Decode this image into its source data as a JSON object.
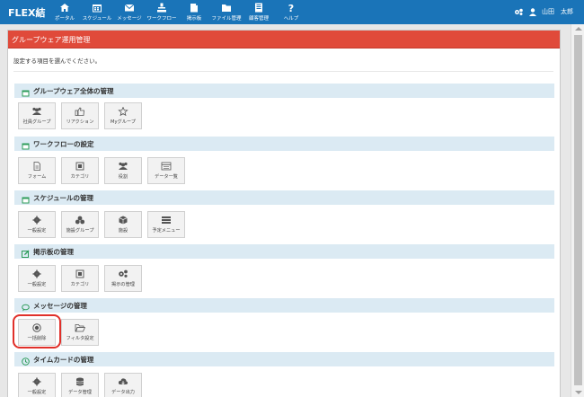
{
  "brand": {
    "logo": "FLEX結"
  },
  "nav": [
    {
      "label": "ポータル",
      "icon": "home-icon"
    },
    {
      "label": "スケジュール",
      "icon": "calendar-icon"
    },
    {
      "label": "メッセージ",
      "icon": "envelope-icon"
    },
    {
      "label": "ワークフロー",
      "icon": "workflow-icon"
    },
    {
      "label": "掲示板",
      "icon": "board-icon"
    },
    {
      "label": "ファイル管理",
      "icon": "folder-icon"
    },
    {
      "label": "顧客管理",
      "icon": "customer-icon"
    },
    {
      "label": "ヘルプ",
      "icon": "help-icon"
    }
  ],
  "user": {
    "name": "山田　太郎"
  },
  "panel": {
    "title": "グループウェア運用管理",
    "intro": "設定する項目を選んでください。"
  },
  "sections": [
    {
      "title": "グループウェア全体の管理",
      "icon": "calendar-icon",
      "tiles": [
        {
          "label": "社員グループ",
          "icon": "users-icon"
        },
        {
          "label": "リアクション",
          "icon": "thumbs-up-icon"
        },
        {
          "label": "Myグループ",
          "icon": "star-icon"
        }
      ]
    },
    {
      "title": "ワークフローの設定",
      "icon": "calendar-icon",
      "tiles": [
        {
          "label": "フォーム",
          "icon": "document-icon"
        },
        {
          "label": "カテゴリ",
          "icon": "category-icon"
        },
        {
          "label": "役割",
          "icon": "users-icon"
        },
        {
          "label": "データ一覧",
          "icon": "list-icon"
        }
      ]
    },
    {
      "title": "スケジュールの管理",
      "icon": "calendar-icon",
      "tiles": [
        {
          "label": "一般設定",
          "icon": "gear-icon"
        },
        {
          "label": "施設グループ",
          "icon": "facility-group-icon"
        },
        {
          "label": "施設",
          "icon": "cube-icon"
        },
        {
          "label": "予定メニュー",
          "icon": "menu-icon"
        }
      ]
    },
    {
      "title": "掲示板の管理",
      "icon": "edit-icon",
      "tiles": [
        {
          "label": "一般設定",
          "icon": "gear-icon"
        },
        {
          "label": "カテゴリ",
          "icon": "category-icon"
        },
        {
          "label": "掲示の管理",
          "icon": "gears-icon"
        }
      ]
    },
    {
      "title": "メッセージの管理",
      "icon": "chat-icon",
      "tiles": [
        {
          "label": "一括削除",
          "icon": "record-icon"
        },
        {
          "label": "フィルタ設定",
          "icon": "folder-open-icon"
        }
      ]
    },
    {
      "title": "タイムカードの管理",
      "icon": "clock-icon",
      "tiles": [
        {
          "label": "一般設定",
          "icon": "gear-icon"
        },
        {
          "label": "データ管理",
          "icon": "database-icon"
        },
        {
          "label": "データ出力",
          "icon": "cloud-download-icon"
        }
      ]
    }
  ],
  "colors": {
    "topbar": "#1a74b8",
    "panel_header": "#e04a3a",
    "section_bg": "#dbeaf3",
    "highlight": "#e0302a",
    "section_icon": "#2e9c5a"
  }
}
